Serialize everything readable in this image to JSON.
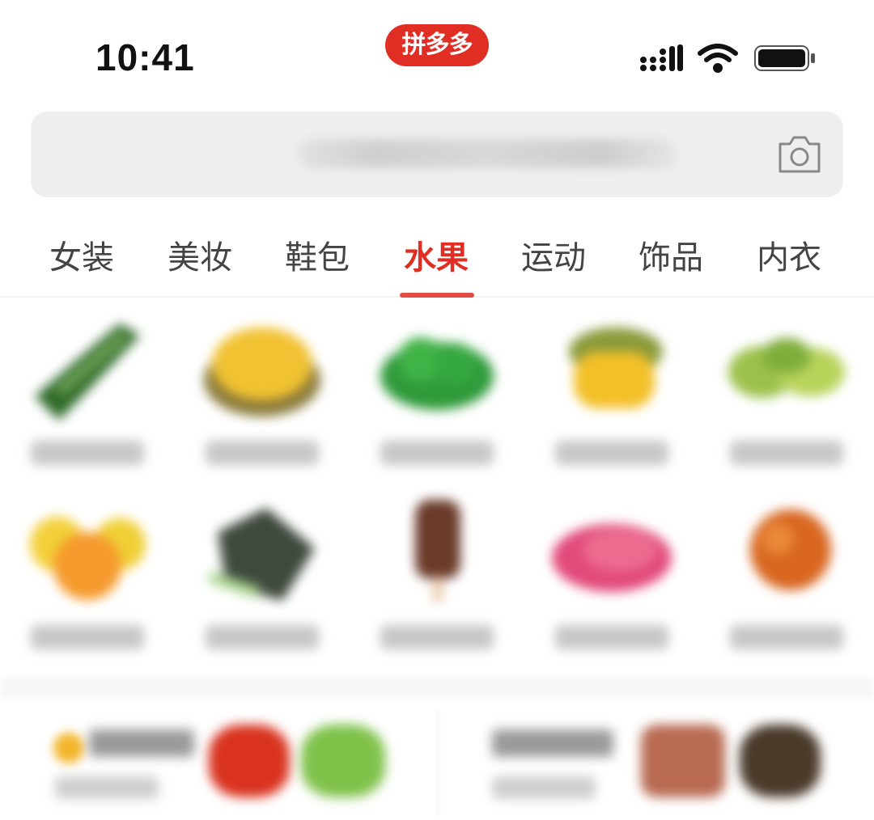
{
  "status_bar": {
    "time": "10:41",
    "brand_logo_text": "拼多多",
    "icons": [
      "cellular-signal-icon",
      "wifi-icon",
      "battery-icon"
    ]
  },
  "search": {
    "placeholder_text": "",
    "icon": "camera-icon"
  },
  "tabs": [
    {
      "label": "女装",
      "active": false
    },
    {
      "label": "美妆",
      "active": false
    },
    {
      "label": "鞋包",
      "active": false
    },
    {
      "label": "水果",
      "active": true
    },
    {
      "label": "运动",
      "active": false
    },
    {
      "label": "饰品",
      "active": false
    },
    {
      "label": "内衣",
      "active": false
    }
  ],
  "colors": {
    "accent": "#e02e24",
    "search_bg": "#efefef",
    "tab_text": "#444444"
  },
  "category_grid": {
    "rows": 2,
    "columns": 5,
    "items": [
      {
        "image": "cucumber"
      },
      {
        "image": "melon"
      },
      {
        "image": "green-vegetables"
      },
      {
        "image": "yellow-fruit"
      },
      {
        "image": "green-fruit"
      },
      {
        "image": "citrus"
      },
      {
        "image": "dark-greens"
      },
      {
        "image": "ice-bar"
      },
      {
        "image": "red-meat"
      },
      {
        "image": "orange-fruit"
      }
    ]
  },
  "bottom_cards": [
    {
      "icon": "flame-icon",
      "images": [
        "red-fruit",
        "green-fruit"
      ]
    },
    {
      "images": [
        "meat-slices",
        "dish-bowl"
      ]
    }
  ]
}
